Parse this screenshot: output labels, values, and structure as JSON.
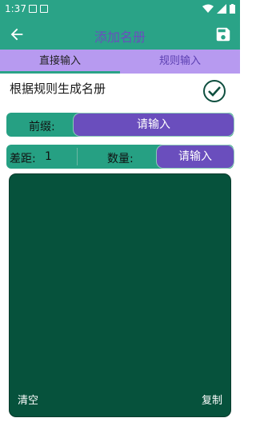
{
  "status_bar": {
    "time": "1:37"
  },
  "app_bar": {
    "title": "添加名册"
  },
  "tabs": [
    {
      "label": "直接输入"
    },
    {
      "label": "规则输入"
    }
  ],
  "content": {
    "heading": "根据规则生成名册",
    "prefix": {
      "label": "前缀:",
      "placeholder_text": "请输入"
    },
    "spacing": {
      "label": "差距:",
      "value": "1"
    },
    "count": {
      "label": "数量:",
      "placeholder_text": "请输入"
    },
    "text_area": {
      "clear_label": "清空",
      "copy_label": "复制"
    }
  },
  "colors": {
    "primary": "#2aa387",
    "tab_bar": "#b79af0",
    "accent": "#6a4ebd",
    "text_area_bg": "#06523c"
  },
  "icons": [
    "back-arrow-icon",
    "save-icon",
    "check-circle-icon",
    "wifi-icon",
    "signal-icon",
    "battery-icon",
    "image-icon",
    "text-icon"
  ]
}
